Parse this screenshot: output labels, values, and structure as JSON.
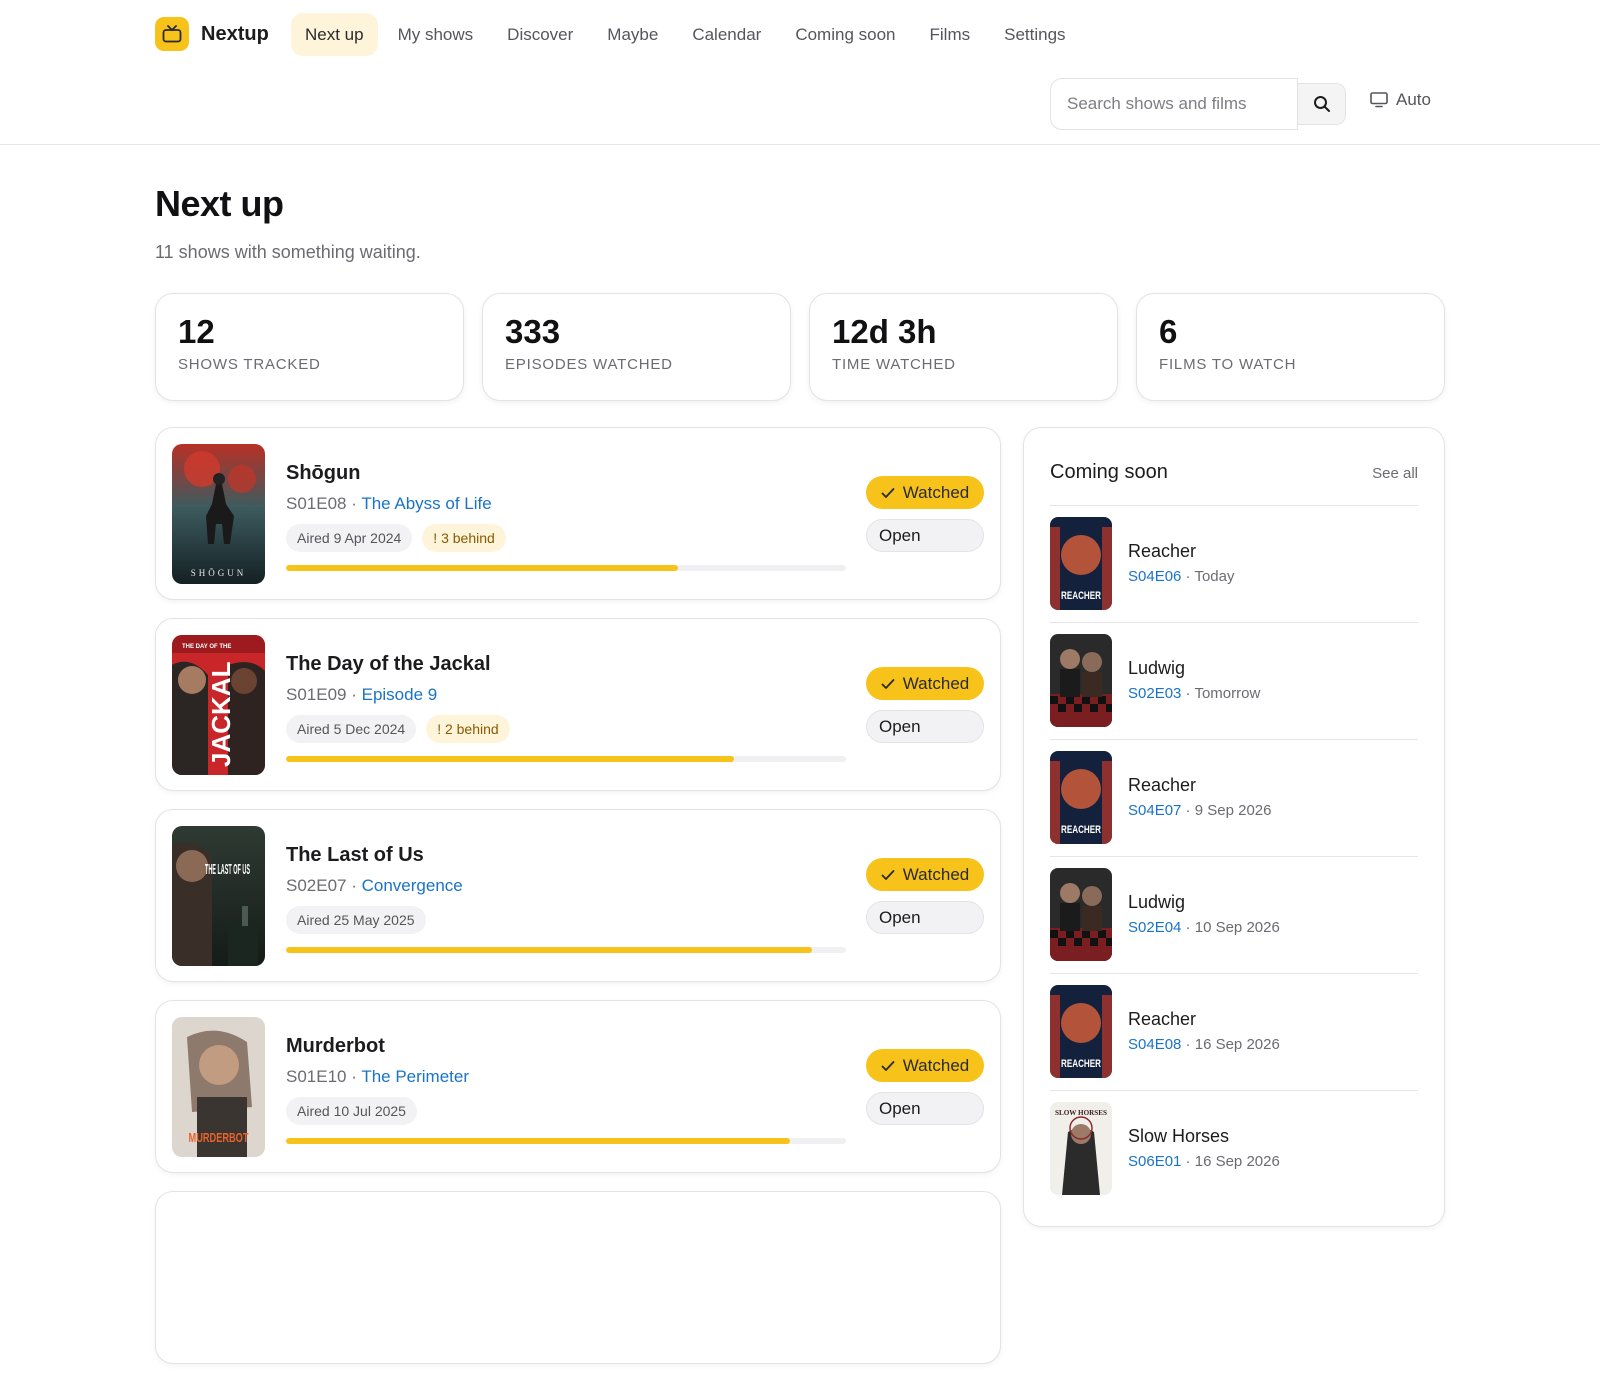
{
  "app": {
    "name": "Nextup",
    "logo_icon": "tv-icon",
    "accent": "#f7c21a",
    "link_color": "#1a73c8"
  },
  "nav": {
    "items": [
      "Next up",
      "My shows",
      "Discover",
      "Maybe",
      "Calendar",
      "Coming soon",
      "Films",
      "Settings"
    ],
    "active": "Next up"
  },
  "search": {
    "placeholder": "Search shows and films",
    "value": "",
    "button_icon": "search-icon"
  },
  "theme": {
    "label": "Auto",
    "icon": "monitor-icon"
  },
  "page": {
    "title": "Next up",
    "subtitle": "11 shows with something waiting."
  },
  "stats": [
    {
      "value": "12",
      "label": "Shows tracked"
    },
    {
      "value": "333",
      "label": "Episodes watched"
    },
    {
      "value": "12d 3h",
      "label": "Time watched"
    },
    {
      "value": "6",
      "label": "Films to watch"
    }
  ],
  "episodes": [
    {
      "show": "Shōgun",
      "code": "S01E08",
      "sep": " · ",
      "title": "The Abyss of Life",
      "aired": "Aired 9 Apr 2024",
      "behind": "! 3 behind",
      "progress": 0.7,
      "poster_text": "SHŌGUN",
      "watched_label": "Watched",
      "open_label": "Open"
    },
    {
      "show": "The Day of the Jackal",
      "code": "S01E09",
      "sep": " · ",
      "title": "Episode 9",
      "aired": "Aired 5 Dec 2024",
      "behind": "! 2 behind",
      "progress": 0.8,
      "poster_text": "JACKAL",
      "poster_small_text": "THE DAY OF THE",
      "watched_label": "Watched",
      "open_label": "Open"
    },
    {
      "show": "The Last of Us",
      "code": "S02E07",
      "sep": " · ",
      "title": "Convergence",
      "aired": "Aired 25 May 2025",
      "behind": "",
      "progress": 0.94,
      "poster_text": "THE LAST OF US",
      "watched_label": "Watched",
      "open_label": "Open"
    },
    {
      "show": "Murderbot",
      "code": "S01E10",
      "sep": " · ",
      "title": "The Perimeter",
      "aired": "Aired 10 Jul 2025",
      "behind": "",
      "progress": 0.9,
      "poster_text": "MURDERBOT",
      "watched_label": "Watched",
      "open_label": "Open"
    }
  ],
  "coming_soon": {
    "title": "Coming soon",
    "see_all": "See all",
    "items": [
      {
        "show": "Reacher",
        "code": "S04E06",
        "sep": " · ",
        "when": "Today",
        "poster_text": "REACHER"
      },
      {
        "show": "Ludwig",
        "code": "S02E03",
        "sep": " · ",
        "when": "Tomorrow",
        "poster_text": ""
      },
      {
        "show": "Reacher",
        "code": "S04E07",
        "sep": " · ",
        "when": "9 Sep 2026",
        "poster_text": "REACHER"
      },
      {
        "show": "Ludwig",
        "code": "S02E04",
        "sep": " · ",
        "when": "10 Sep 2026",
        "poster_text": ""
      },
      {
        "show": "Reacher",
        "code": "S04E08",
        "sep": " · ",
        "when": "16 Sep 2026",
        "poster_text": "REACHER"
      },
      {
        "show": "Slow Horses",
        "code": "S06E01",
        "sep": " · ",
        "when": "16 Sep 2026",
        "poster_text": "SLOW HORSES"
      }
    ]
  }
}
